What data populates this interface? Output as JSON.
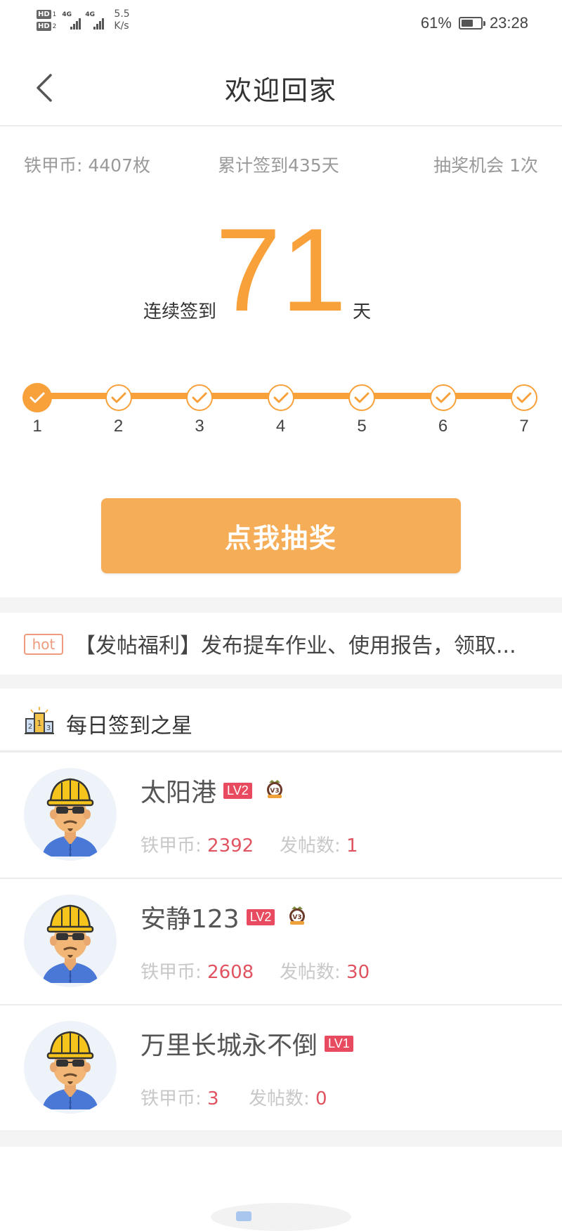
{
  "status_bar": {
    "hd1": "HD",
    "hd1_sub": "1",
    "hd2": "HD",
    "hd2_sub": "2",
    "net1": "4G",
    "net2": "4G",
    "speed": "5.5",
    "speed_unit": "K/s",
    "battery": "61%",
    "battery_level": 0.61,
    "time": "23:28"
  },
  "header": {
    "back_icon": "chevron-left-icon",
    "title": "欢迎回家"
  },
  "stats": {
    "coins": "铁甲币: 4407枚",
    "total_checkin": "累计签到435天",
    "lottery_chances": "抽奖机会 1次"
  },
  "streak": {
    "label": "连续签到",
    "days": "71",
    "unit": "天"
  },
  "progress": {
    "steps": [
      "1",
      "2",
      "3",
      "4",
      "5",
      "6",
      "7"
    ],
    "completed": 1,
    "color": "#f8a13a"
  },
  "draw_button": {
    "label": "点我抽奖",
    "color": "#f6ad57"
  },
  "notice": {
    "badge": "hot",
    "text": "【发帖福利】发布提车作业、使用报告，领取..."
  },
  "stars_section": {
    "icon": "podium-icon",
    "title": "每日签到之星",
    "coins_label": "铁甲币: ",
    "posts_label": "发帖数: ",
    "users": [
      {
        "name": "太阳港",
        "level": "LV2",
        "medal": "V3",
        "coins": "2392",
        "posts": "1"
      },
      {
        "name": "安静123",
        "level": "LV2",
        "medal": "V3",
        "coins": "2608",
        "posts": "30"
      },
      {
        "name": "万里长城永不倒",
        "level": "LV1",
        "medal": "",
        "coins": "3",
        "posts": "0"
      }
    ]
  }
}
